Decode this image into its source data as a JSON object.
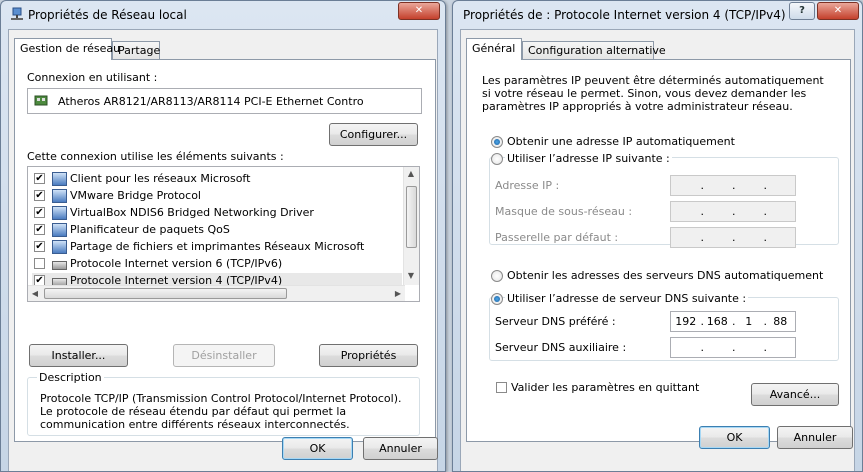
{
  "left_dialog": {
    "title": "Propriétés de Réseau local",
    "tabs": [
      "Gestion de réseau",
      "Partage"
    ],
    "connect_label": "Connexion en utilisant :",
    "adapter": "Atheros AR8121/AR8113/AR8114 PCI-E Ethernet Contro",
    "configure": "Configurer...",
    "elements_label": "Cette connexion utilise les éléments suivants :",
    "items": [
      {
        "label": "Client pour les réseaux Microsoft",
        "checked": true
      },
      {
        "label": "VMware Bridge Protocol",
        "checked": true
      },
      {
        "label": "VirtualBox NDIS6 Bridged Networking Driver",
        "checked": true
      },
      {
        "label": "Planificateur de paquets QoS",
        "checked": true
      },
      {
        "label": "Partage de fichiers et imprimantes Réseaux Microsoft",
        "checked": true
      },
      {
        "label": "Protocole Internet version 6 (TCP/IPv6)",
        "checked": false
      },
      {
        "label": "Protocole Internet version 4 (TCP/IPv4)",
        "checked": true
      }
    ],
    "install": "Installer...",
    "uninstall": "Désinstaller",
    "properties": "Propriétés",
    "description_title": "Description",
    "description": "Protocole TCP/IP (Transmission Control Protocol/Internet Protocol). Le protocole de réseau étendu par défaut qui permet la communication entre différents réseaux interconnectés.",
    "ok": "OK",
    "cancel": "Annuler"
  },
  "right_dialog": {
    "title": "Propriétés de : Protocole Internet version 4 (TCP/IPv4)",
    "tabs": [
      "Général",
      "Configuration alternative"
    ],
    "intro": "Les paramètres IP peuvent être déterminés automatiquement si votre réseau le permet. Sinon, vous devez demander les paramètres IP appropriés à votre administrateur réseau.",
    "ip_auto": "Obtenir une adresse IP automatiquement",
    "ip_manual": "Utiliser l’adresse IP suivante :",
    "ip_mode": "auto",
    "ip_address_label": "Adresse IP :",
    "subnet_label": "Masque de sous-réseau :",
    "gateway_label": "Passerelle par défaut :",
    "dns_auto": "Obtenir les adresses des serveurs DNS automatiquement",
    "dns_manual": "Utiliser l’adresse de serveur DNS suivante :",
    "dns_mode": "manual",
    "preferred_dns_label": "Serveur DNS préféré :",
    "preferred_dns": [
      "192",
      "168",
      "1",
      "88"
    ],
    "alternate_dns_label": "Serveur DNS auxiliaire :",
    "validate_label": "Valider les paramètres en quittant",
    "validate_checked": false,
    "advanced": "Avancé...",
    "ok": "OK",
    "cancel": "Annuler"
  },
  "colors": {
    "window_frame": "#c6d5e6",
    "close_button": "#c4402c",
    "radio_selected": "#175ea0"
  }
}
